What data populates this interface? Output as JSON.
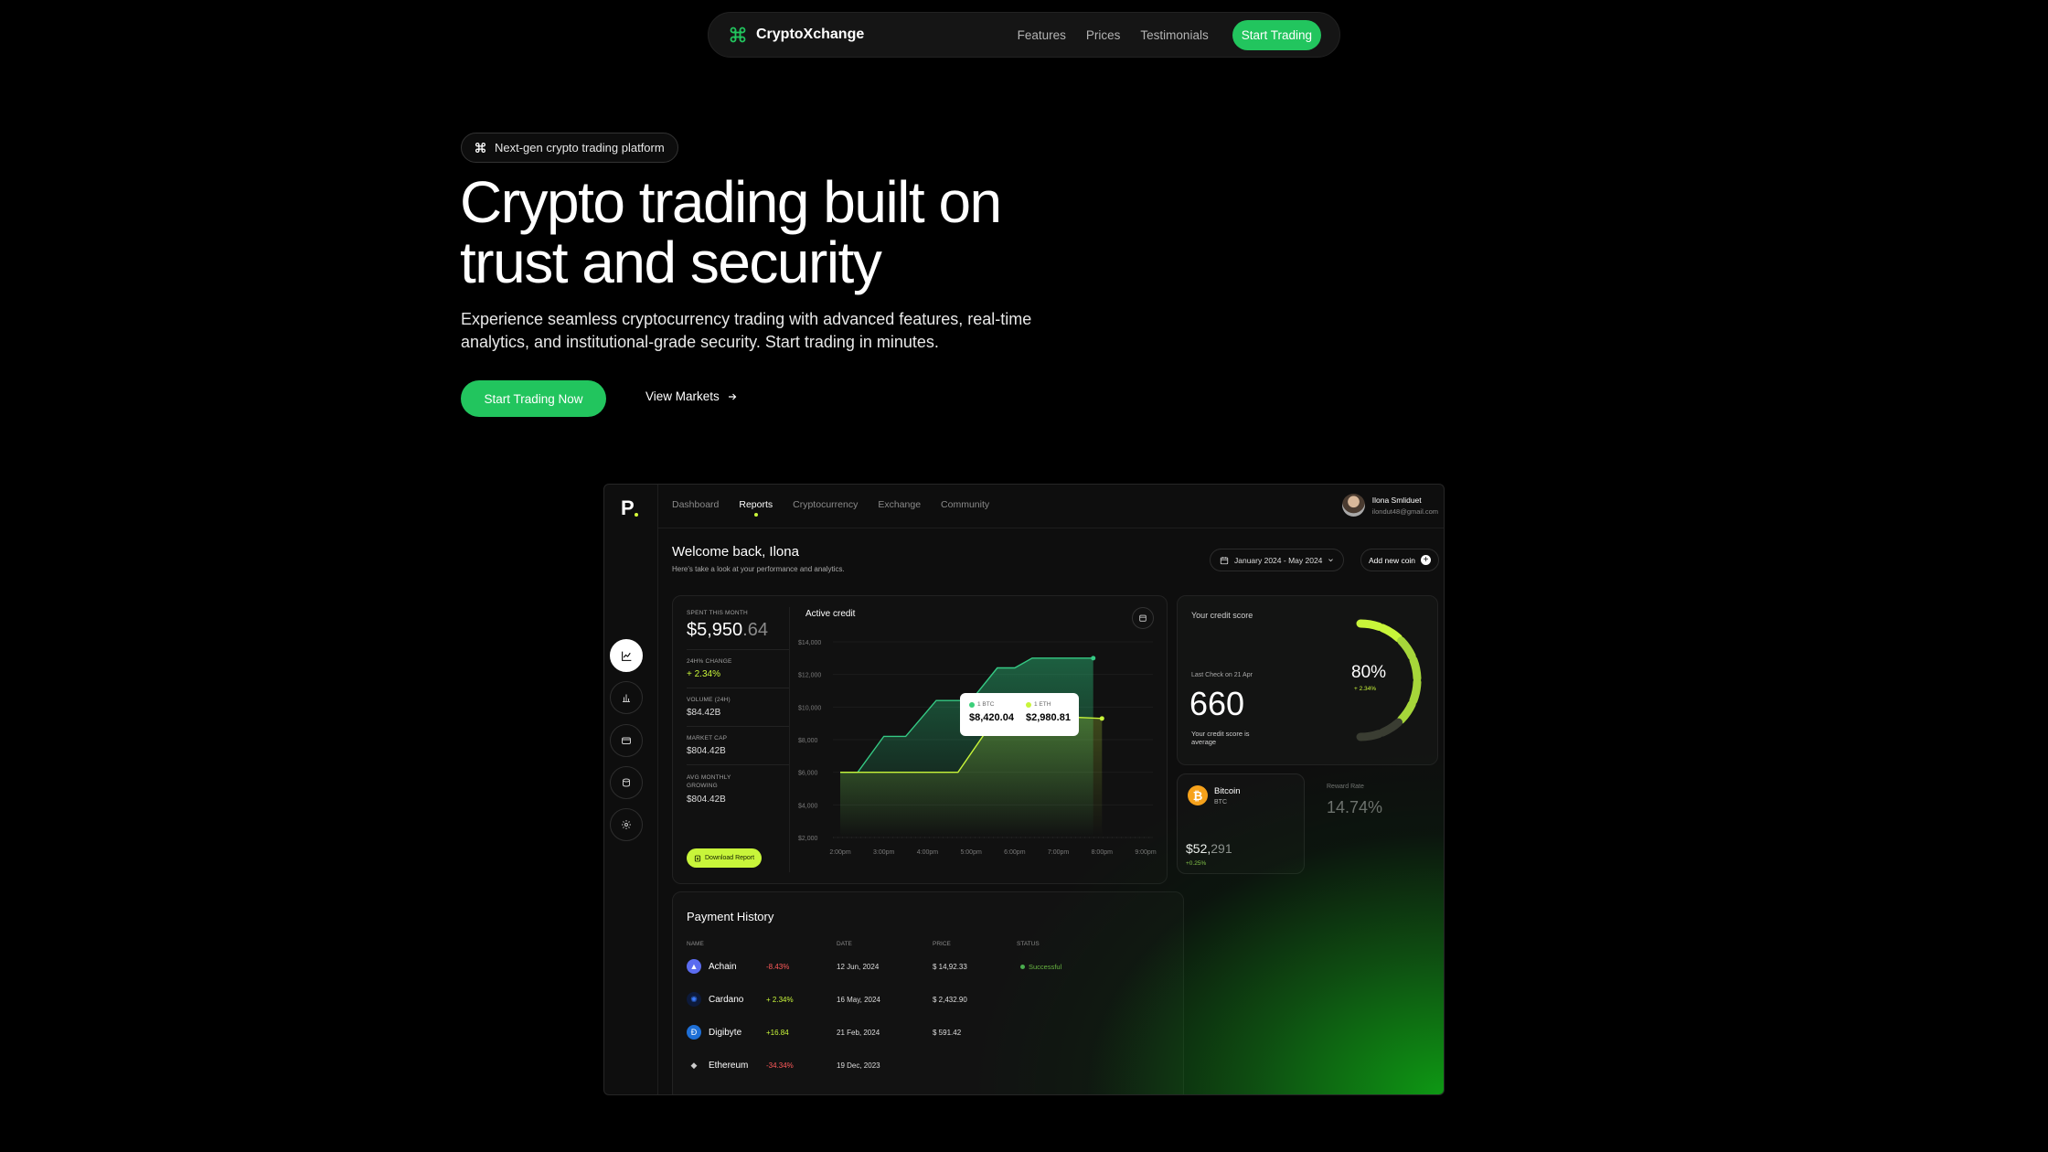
{
  "nav": {
    "brand": "CryptoXchange",
    "links": [
      "Features",
      "Prices",
      "Testimonials"
    ],
    "cta": "Start Trading"
  },
  "hero": {
    "badge": "Next-gen crypto trading platform",
    "title_line1": "Crypto trading built on",
    "title_line2": "trust and security",
    "subtitle": "Experience seamless cryptocurrency trading with advanced features, real-time analytics, and institutional-grade security. Start trading in minutes.",
    "primary_cta": "Start Trading Now",
    "secondary_cta": "View Markets"
  },
  "dashboard": {
    "logo": "P",
    "tabs": [
      "Dashboard",
      "Reports",
      "Cryptocurrency",
      "Exchange",
      "Community"
    ],
    "active_tab": "Reports",
    "user": {
      "name": "Ilona Smliduet",
      "email": "ilondut48@gmail.com"
    },
    "welcome": "Welcome back, Ilona",
    "welcome_sub": "Here's  take a look at your performance and analytics.",
    "date_range": "January 2024 - May 2024",
    "add_coin": "Add new coin",
    "stats": {
      "spent_label": "SPENT THIS MONTH",
      "spent_main": "$5,950",
      "spent_cents": ".64",
      "change_label": "24H% CHANGE",
      "change_value": "+ 2.34%",
      "volume_label": "VOLUME (24H)",
      "volume_value": "$84.42B",
      "marketcap_label": "MARKET CAP",
      "marketcap_value": "$804.42B",
      "growing_label": "AVG MONTHLY GROWING",
      "growing_value": "$804.42B",
      "download": "Download Report"
    },
    "active_credit": {
      "title": "Active credit",
      "tooltip": {
        "btc_label": "1 BTC",
        "btc_value": "$8,420.04",
        "eth_label": "1 ETH",
        "eth_value": "$2,980.81"
      }
    },
    "credit_score": {
      "title": "Your credit score",
      "last_check": "Last Check on 21 Apr",
      "score": "660",
      "note": "Your credit score is average",
      "percent": "80%",
      "change": "+ 2.34%",
      "percent_value": 80
    },
    "bitcoin": {
      "name": "Bitcoin",
      "symbol": "BTC",
      "price_main": "$52,",
      "price_rest": "291",
      "change": "+0.25%"
    },
    "reward": {
      "label": "Reward Rate",
      "value": "14.74%"
    },
    "payments": {
      "title": "Payment History",
      "headers": [
        "NAME",
        "DATE",
        "PRICE",
        "STATUS"
      ],
      "rows": [
        {
          "name": "Achain",
          "change": "-8.43%",
          "date": "12 Jun, 2024",
          "price": "$ 14,92.33",
          "status": "Successful"
        },
        {
          "name": "Cardano",
          "change": "+ 2.34%",
          "date": "16 May, 2024",
          "price": "$ 2,432.90",
          "status": ""
        },
        {
          "name": "Digibyte",
          "change": "+16.84",
          "date": "21 Feb, 2024",
          "price": "$ 591.42",
          "status": ""
        },
        {
          "name": "Ethereum",
          "change": "-34.34%",
          "date": "19 Dec, 2023",
          "price": "",
          "status": ""
        }
      ]
    },
    "colors": {
      "accent": "#c8f53a",
      "brand_green": "#22c55e",
      "btc": "#f7a21b"
    }
  },
  "chart_data": {
    "type": "line",
    "title": "Active credit",
    "categories": [
      "2:00pm",
      "3:00pm",
      "4:00pm",
      "5:00pm",
      "6:00pm",
      "7:00pm",
      "8:00pm",
      "9:00pm"
    ],
    "y_ticks": [
      "$14,000",
      "$12,000",
      "$10,000",
      "$8,000",
      "$6,000",
      "$4,000",
      "$2,000"
    ],
    "ylim": [
      2000,
      14000
    ],
    "series": [
      {
        "name": "BTC",
        "x": [
          0,
          0.4,
          1.0,
          1.5,
          2.2,
          2.6,
          3.0,
          3.6,
          4.0,
          4.4,
          5.8
        ],
        "values": [
          6000,
          6000,
          8200,
          8200,
          10400,
          10400,
          10400,
          12400,
          12400,
          13000,
          13000
        ]
      },
      {
        "name": "ETH",
        "x": [
          0,
          2.7,
          3.6,
          4.3,
          6.0
        ],
        "values": [
          6000,
          6000,
          9500,
          9500,
          9300
        ]
      }
    ],
    "grid": true
  }
}
